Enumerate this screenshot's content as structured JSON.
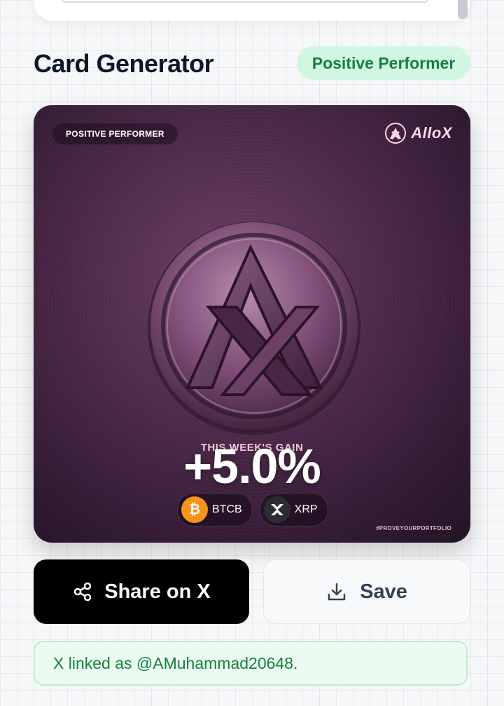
{
  "header": {
    "title": "Card Generator",
    "status": "Positive Performer"
  },
  "card": {
    "badge": "POSITIVE PERFORMER",
    "brand": "AlloX",
    "gain_label": "THIS WEEK'S GAIN",
    "gain_value": "+5.0%",
    "assets": [
      {
        "symbol": "BTCB",
        "icon": "bitcoin-icon"
      },
      {
        "symbol": "XRP",
        "icon": "xrp-icon"
      }
    ],
    "hashtag": "#PROVEYOURPORTFOLIO"
  },
  "actions": {
    "share_label": "Share on X",
    "share_icon": "share-icon",
    "save_label": "Save",
    "save_icon": "download-icon"
  },
  "notice": {
    "text": "X linked as @AMuhammad20648."
  },
  "colors": {
    "accent_green": "#15803d",
    "card_purple": "#4e2a4b",
    "share_button": "#000000"
  }
}
